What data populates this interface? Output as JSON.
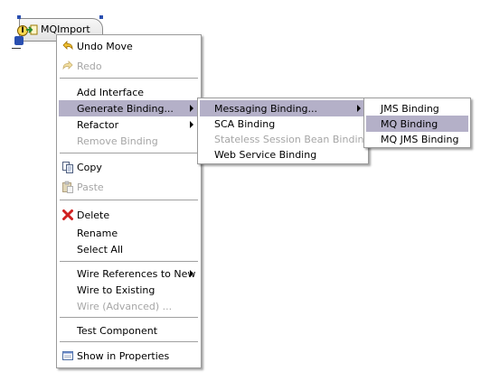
{
  "node": {
    "label": "MQImport"
  },
  "context_menu": {
    "items": [
      {
        "label": "Undo Move",
        "icon": "undo-icon",
        "enabled": true
      },
      {
        "label": "Redo",
        "icon": "redo-icon",
        "enabled": false
      },
      {
        "label": "Add Interface",
        "enabled": true
      },
      {
        "label": "Generate Binding...",
        "enabled": true,
        "submenu": true,
        "highlighted": true
      },
      {
        "label": "Refactor",
        "enabled": true,
        "submenu": true
      },
      {
        "label": "Remove Binding",
        "enabled": false
      },
      {
        "label": "Copy",
        "icon": "copy-icon",
        "enabled": true
      },
      {
        "label": "Paste",
        "icon": "paste-icon",
        "enabled": false
      },
      {
        "label": "Delete",
        "icon": "delete-icon",
        "enabled": true
      },
      {
        "label": "Rename",
        "enabled": true
      },
      {
        "label": "Select All",
        "enabled": true
      },
      {
        "label": "Wire References to New",
        "enabled": true,
        "submenu": true
      },
      {
        "label": "Wire to Existing",
        "enabled": true
      },
      {
        "label": "Wire (Advanced) ...",
        "enabled": false
      },
      {
        "label": "Test Component",
        "enabled": true
      },
      {
        "label": "Show in Properties",
        "icon": "properties-icon",
        "enabled": true
      }
    ]
  },
  "binding_submenu": {
    "items": [
      {
        "label": "Messaging Binding...",
        "enabled": true,
        "submenu": true,
        "highlighted": true
      },
      {
        "label": "SCA Binding",
        "enabled": true
      },
      {
        "label": "Stateless Session Bean Binding",
        "enabled": false
      },
      {
        "label": "Web Service Binding",
        "enabled": true
      }
    ]
  },
  "messaging_submenu": {
    "items": [
      {
        "label": "JMS Binding",
        "enabled": true
      },
      {
        "label": "MQ Binding",
        "enabled": true,
        "highlighted": true
      },
      {
        "label": "MQ JMS Binding",
        "enabled": true
      }
    ]
  },
  "colors": {
    "highlight": "#b4b0c8",
    "disabled_text": "#a6a6a6",
    "menu_border": "#9a9a9a"
  }
}
